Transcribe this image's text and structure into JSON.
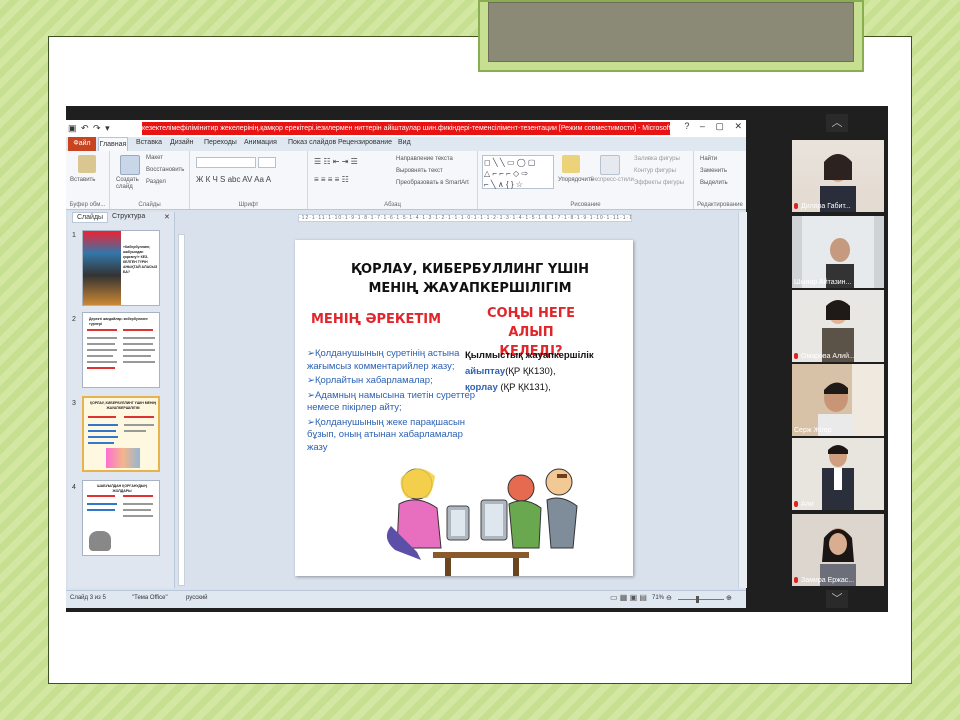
{
  "window": {
    "title": "кезектелімефілімінитир жекелерінің.қамқор ерекітері.іезилермен ниттерін айіштаулар шин.фикіндері-теменсілімент-тезентации [Режим совместимости] - Microsoft PowerPoint (Сбой активации продукта)"
  },
  "ribbon_tabs": [
    "Файл",
    "Главная",
    "Вставка",
    "Дизайн",
    "Переходы",
    "Анимация",
    "Показ слайдов",
    "Рецензирование",
    "Вид"
  ],
  "ribbon": {
    "clipboard": {
      "paste": "Вставить",
      "label": "Буфер обм..."
    },
    "slides": {
      "create": "Создать слайд",
      "layout": "Макет",
      "reset": "Восстановить",
      "section": "Раздел",
      "label": "Слайды"
    },
    "font": {
      "label": "Шрифт"
    },
    "paragraph": {
      "direction": "Направление текста",
      "align": "Выровнять текст",
      "smartart": "Преобразовать в SmartArt",
      "label": "Абзац"
    },
    "drawing": {
      "arrange": "Упорядочить",
      "styles": "Экспресс-стили",
      "fill": "Заливка фигуры",
      "outline": "Контур фигуры",
      "effects": "Эффекты фигуры",
      "label": "Рисование"
    },
    "editing": {
      "find": "Найти",
      "replace": "Заменить",
      "select": "Выделить",
      "label": "Редактирование"
    }
  },
  "panel_tabs": {
    "slides": "Слайды",
    "outline": "Структура"
  },
  "thumbnails": [
    {
      "num": "1",
      "text": "«Кибербуллинг, шабуылдан қорғану!» КЕЗ-КЕЛГЕН ТҮРІН АНЫҚТАЙ АЛАСЫЗ БА?"
    },
    {
      "num": "2",
      "text": "Деректі жағдайлар: кибербуллинг түрлері"
    },
    {
      "num": "3",
      "text": "ҚОРЛАУ, КИБЕРБУЛЛИНГ ҮШІН МЕНІҢ ЖАУАПКЕРШІЛІГІМ"
    },
    {
      "num": "4",
      "text": "ШАБУЫЛДАН ҚОРҒАНУДЫҢ ЖОЛДАРЫ"
    }
  ],
  "ruler": "·12·1·11·1·10·1·9·1·8·1·7·1·6·1·5·1·4·1·3·1·2·1·1·1·0·1·1·1·2·1·3·1·4·1·5·1·6·1·7·1·8·1·9·1·10·1·11·1·12·",
  "slide": {
    "title": "ҚОРЛАУ, КИБЕРБУЛЛИНГ ҮШІН МЕНІҢ ЖАУАПКЕРШІЛІГІМ",
    "left_heading": "МЕНІҢ ӘРЕКЕТІМ",
    "right_heading": "СОҢЫ НЕГЕ АЛЫП КЕЛЕДІ?",
    "left_items": [
      "Қолданушының суретінің астына жағымсыз комментарийлер жазу;",
      "Қорлайтын хабарламалар;",
      "Адамның намысына тиетін суреттер немесе пікірлер айту;",
      "Қолданушының жеке парақшасын бұзып, оның атынан хабарламалар жазу"
    ],
    "right_title": "Қылмыстық жауапкершілік",
    "right_items": [
      {
        "term": "айыптау",
        "ref": "(ҚР ҚК130),"
      },
      {
        "term": "қорлау",
        "ref": "(ҚР ҚК131),"
      }
    ]
  },
  "statusbar": {
    "slide_count": "Слайд 3 из 5",
    "theme": "\"Тема Office\"",
    "language": "русский",
    "zoom": "71%"
  },
  "participants": [
    {
      "name": "Диляра Габит..."
    },
    {
      "name": "Шынар Айтазин..."
    },
    {
      "name": "Омарова Алий..."
    },
    {
      "name": "Серж Жігер"
    },
    {
      "name": "Али"
    },
    {
      "name": "Замира Ержас..."
    }
  ],
  "colors": {
    "accent_red": "#e0262b",
    "link_blue": "#2d62b4",
    "file_tab": "#c8431f"
  }
}
